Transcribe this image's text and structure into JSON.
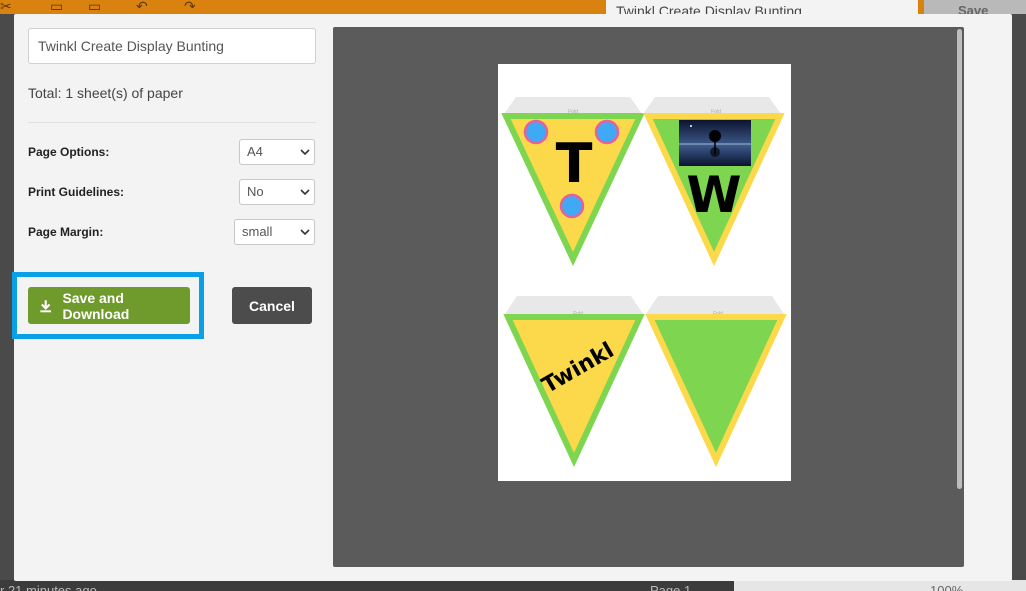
{
  "app": {
    "doc_title": "Twinkl Create Display Bunting",
    "save_label": "Save",
    "status_left": "r 21 minutes ago",
    "status_page": "Page 1",
    "status_zoom": "100%"
  },
  "modal": {
    "title_input_value": "Twinkl Create Display Bunting",
    "total_text": "Total: 1 sheet(s) of paper",
    "options": {
      "page_options_label": "Page Options:",
      "page_options_value": "A4",
      "print_guidelines_label": "Print Guidelines:",
      "print_guidelines_value": "No",
      "page_margin_label": "Page Margin:",
      "page_margin_value": "small"
    },
    "save_download_label": "Save and Download",
    "cancel_label": "Cancel"
  },
  "preview": {
    "fold_label": "Fold",
    "flag_letters": [
      "T",
      "W",
      "Twinkl"
    ],
    "colors": {
      "green": "#7ed650",
      "yellow": "#fcd94a",
      "dot": "#3fa9f5",
      "dot_border": "#e8609a"
    },
    "icons": [
      "download-icon",
      "chevron-down-icon"
    ]
  }
}
